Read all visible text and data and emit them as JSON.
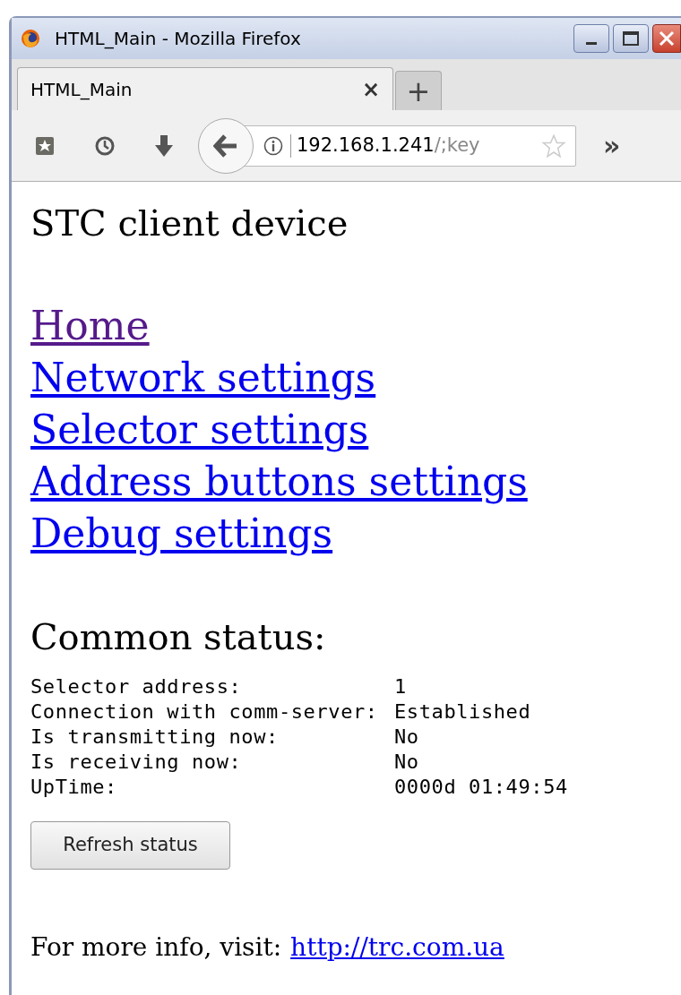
{
  "window": {
    "title": "HTML_Main - Mozilla Firefox"
  },
  "tabs": [
    {
      "label": "HTML_Main",
      "selected": true,
      "close": "×"
    }
  ],
  "new_tab": "+",
  "address_bar": {
    "host": "192.168.1.241",
    "path": "/;key"
  },
  "overflow": "»",
  "page": {
    "heading": "STC client device",
    "links": [
      {
        "label": "Home",
        "visited": true
      },
      {
        "label": "Network settings",
        "visited": false
      },
      {
        "label": "Selector settings",
        "visited": false
      },
      {
        "label": "Address buttons settings",
        "visited": false
      },
      {
        "label": "Debug settings",
        "visited": false
      }
    ],
    "status_heading": "Common status:",
    "status": [
      {
        "label": "Selector address:",
        "value": "1"
      },
      {
        "label": "Connection with comm-server:",
        "value": "Established"
      },
      {
        "label": "Is transmitting now:",
        "value": "No"
      },
      {
        "label": "Is receiving now:",
        "value": "No"
      },
      {
        "label": "UpTime:",
        "value": "0000d 01:49:54"
      }
    ],
    "button": "Refresh status",
    "footer": {
      "text": "For more info, visit:",
      "link": "http://trc.com.ua"
    }
  }
}
